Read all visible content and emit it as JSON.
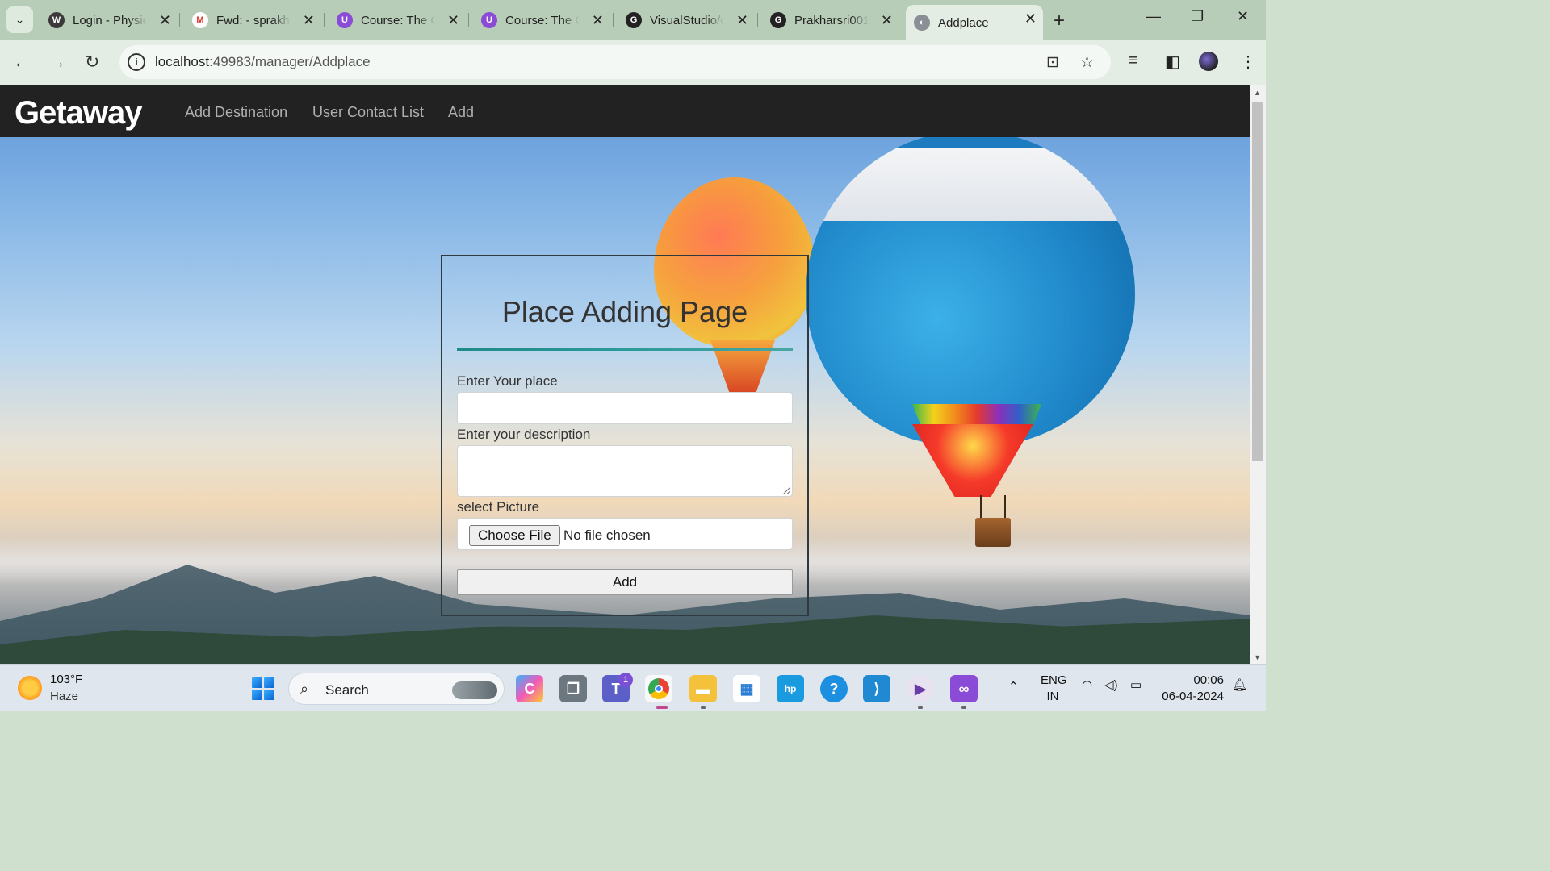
{
  "browser": {
    "tabs": [
      {
        "title": "Login - Physic",
        "favicon": "wordpress-icon",
        "color": "#3a3a3a"
      },
      {
        "title": "Fwd: - sprakha",
        "favicon": "gmail-icon",
        "color": "#d93025"
      },
      {
        "title": "Course: The C",
        "favicon": "course-icon",
        "color": "#8a4bd6"
      },
      {
        "title": "Course: The C",
        "favicon": "course-icon",
        "color": "#8a4bd6"
      },
      {
        "title": "VisualStudio/c",
        "favicon": "github-icon",
        "color": "#222222"
      },
      {
        "title": "Prakharsri001/",
        "favicon": "github-icon",
        "color": "#222222"
      },
      {
        "title": "Addplace",
        "favicon": "globe-icon",
        "color": "#8a8f95"
      }
    ],
    "active_tab": 6,
    "url_host": "localhost",
    "url_path": ":49983/manager/Addplace"
  },
  "site": {
    "brand": "Getaway",
    "nav": [
      "Add Destination",
      "User Contact List",
      "Add"
    ]
  },
  "form": {
    "title": "Place Adding Page",
    "place_label": "Enter Your place",
    "place_value": "",
    "description_label": "Enter your description",
    "description_value": "",
    "picture_label": "select Picture",
    "file_button": "Choose File",
    "file_status": "No file chosen",
    "submit": "Add"
  },
  "taskbar": {
    "weather_temp": "103°F",
    "weather_desc": "Haze",
    "search": "Search",
    "teams_badge": "1",
    "lang_1": "ENG",
    "lang_2": "IN",
    "time": "00:06",
    "date": "06-04-2024"
  },
  "colors": {
    "navbar_bg": "#222222",
    "accent_rule": "#1f8a8a"
  }
}
